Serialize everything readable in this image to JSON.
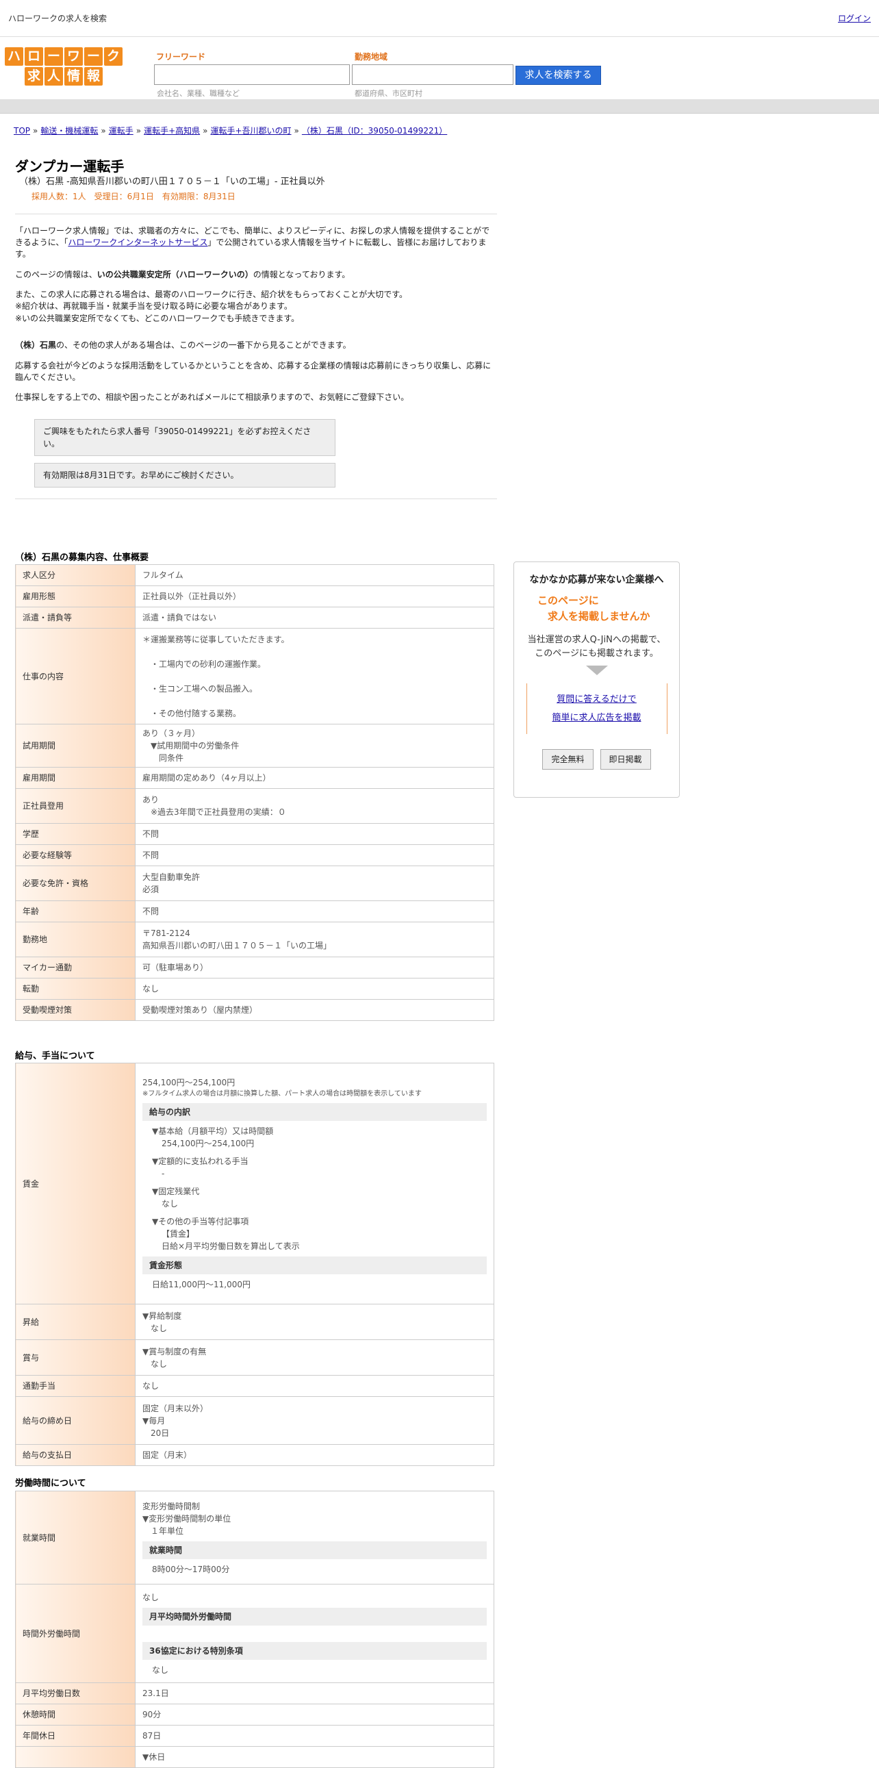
{
  "topbar": {
    "title": "ハローワークの求人を検索",
    "login": "ログイン"
  },
  "logo": {
    "row1": [
      "ハ",
      "ロ",
      "ー",
      "ワ",
      "ー",
      "ク"
    ],
    "row2": [
      "求",
      "人",
      "情",
      "報"
    ]
  },
  "search": {
    "free_label": "フリーワード",
    "free_placeholder": "会社名、業種、職種など",
    "area_label": "勤務地域",
    "area_placeholder": "都道府県、市区町村",
    "button": "求人を検索する"
  },
  "breadcrumb": [
    "TOP",
    "輸送・機械運転",
    "運転手",
    "運転手+高知県",
    "運転手+吾川郡いの町",
    "（株）石黒（ID：39050-01499221）"
  ],
  "job": {
    "title": "ダンプカー運転手",
    "subtitle": "（株）石黒 -高知県吾川郡いの町八田１７０５－１「いの工場」- 正社員以外",
    "meta": "採用人数：1人　受理日：6月1日　有効期限：8月31日"
  },
  "intro": {
    "p1_a": "「ハローワーク求人情報」では、求職者の方々に、どこでも、簡単に、よりスピーディに、お探しの求人情報を提供することができるように、「",
    "p1_link": "ハローワークインターネットサービス",
    "p1_b": "」で公開されている求人情報を当サイトに転載し、皆様にお届けしております。",
    "p2_a": "このページの情報は、",
    "p2_b": "いの公共職業安定所（ハローワークいの）",
    "p2_c": "の情報となっております。",
    "p3": "また、この求人に応募される場合は、最寄のハローワークに行き、紹介状をもらっておくことが大切です。",
    "p3b": "※紹介状は、再就職手当・就業手当を受け取る時に必要な場合があります。",
    "p3c": "※いの公共職業安定所でなくても、どこのハローワークでも手続きできます。",
    "p4_a": "（株）石黒",
    "p4_b": "の、その他の求人がある場合は、このページの一番下から見ることができます。",
    "p5": "応募する会社が今どのような採用活動をしているかということを含め、応募する企業様の情報は応募前にきっちり収集し、応募に臨んでください。",
    "p6": "仕事探しをする上での、相談や困ったことがあればメールにて相談承りますので、お気軽にご登録下さい。",
    "box1": "ご興味をもたれたら求人番号「39050-01499221」を必ずお控えください。",
    "box2": "有効期限は8月31日です。お早めにご検討ください。"
  },
  "section1": {
    "title": "（株）石黒の募集内容、仕事概要",
    "rows": [
      {
        "k": "求人区分",
        "v": [
          "フルタイム"
        ]
      },
      {
        "k": "雇用形態",
        "v": [
          "正社員以外（正社員以外）"
        ]
      },
      {
        "k": "派遣・請負等",
        "v": [
          "派遣・請負ではない"
        ]
      },
      {
        "k": "仕事の内容",
        "v": [
          "＊運搬業務等に従事していただきます。",
          "",
          "　・工場内での砂利の運搬作業。",
          "",
          "　・生コン工場への製品搬入。",
          "",
          "　・その他付随する業務。"
        ]
      },
      {
        "k": "試用期間",
        "v": [
          "あり（３ヶ月）",
          "　▼試用期間中の労働条件",
          "　　同条件"
        ]
      },
      {
        "k": "雇用期間",
        "v": [
          "雇用期間の定めあり（4ヶ月以上）"
        ]
      },
      {
        "k": "正社員登用",
        "v": [
          "あり",
          "　※過去3年間で正社員登用の実績：０"
        ]
      },
      {
        "k": "学歴",
        "v": [
          "不問"
        ]
      },
      {
        "k": "必要な経験等",
        "v": [
          "不問"
        ]
      },
      {
        "k": "必要な免許・資格",
        "v": [
          "大型自動車免許",
          "必須"
        ]
      },
      {
        "k": "年齢",
        "v": [
          "不問"
        ]
      },
      {
        "k": "勤務地",
        "v": [
          "〒781-2124",
          "高知県吾川郡いの町八田１７０５－１「いの工場」"
        ]
      },
      {
        "k": "マイカー通勤",
        "v": [
          "可（駐車場あり）"
        ]
      },
      {
        "k": "転勤",
        "v": [
          "なし"
        ]
      },
      {
        "k": "受動喫煙対策",
        "v": [
          "受動喫煙対策あり（屋内禁煙）"
        ]
      }
    ]
  },
  "section2": {
    "title": "給与、手当について",
    "wage": {
      "k": "賃金",
      "range": "254,100円〜254,100円",
      "note": "※フルタイム求人の場合は月額に換算した額、パート求人の場合は時間額を表示しています",
      "breakdown_h": "給与の内訳",
      "b1": "▼基本給（月額平均）又は時間額",
      "b1v": "254,100円〜254,100円",
      "b2": "▼定額的に支払われる手当",
      "b2v": "-",
      "b3": "▼固定残業代",
      "b3v": "なし",
      "b4": "▼その他の手当等付記事項",
      "b4v1": "【賃金】",
      "b4v2": "日給×月平均労働日数を算出して表示",
      "form_h": "賃金形態",
      "form_v": "日給11,000円〜11,000円"
    },
    "rows": [
      {
        "k": "昇給",
        "v": [
          "▼昇給制度",
          "　なし"
        ]
      },
      {
        "k": "賞与",
        "v": [
          "▼賞与制度の有無",
          "　なし"
        ]
      },
      {
        "k": "通勤手当",
        "v": [
          "なし"
        ]
      },
      {
        "k": "給与の締め日",
        "v": [
          "固定（月末以外）",
          "▼毎月",
          "　20日"
        ]
      },
      {
        "k": "給与の支払日",
        "v": [
          "固定（月末）"
        ]
      }
    ]
  },
  "section3": {
    "title": "労働時間について",
    "work": {
      "k": "就業時間",
      "v1": "変形労働時間制",
      "v2": "▼変形労働時間制の単位",
      "v3": "　１年単位",
      "h": "就業時間",
      "hv": "8時00分〜17時00分"
    },
    "overtime": {
      "k": "時間外労働時間",
      "v": "なし",
      "h1": "月平均時間外労働時間",
      "h2": "36協定における特別条項",
      "h2v": "なし"
    },
    "rows": [
      {
        "k": "月平均労働日数",
        "v": [
          "23.1日"
        ]
      },
      {
        "k": "休憩時間",
        "v": [
          "90分"
        ]
      },
      {
        "k": "年間休日",
        "v": [
          "87日"
        ]
      },
      {
        "k": "",
        "v": [
          "▼休日"
        ]
      }
    ]
  },
  "sidebar": {
    "heading": "なかなか応募が来ない企業様へ",
    "offer1": "このページに",
    "offer2": "　求人を掲載しませんか",
    "desc1": "当社運営の求人Q-JiNへの掲載で、",
    "desc2": "このページにも掲載されます。",
    "link1": "質問に答えるだけで",
    "link2": "簡単に求人広告を掲載",
    "btn1": "完全無料",
    "btn2": "即日掲載"
  }
}
